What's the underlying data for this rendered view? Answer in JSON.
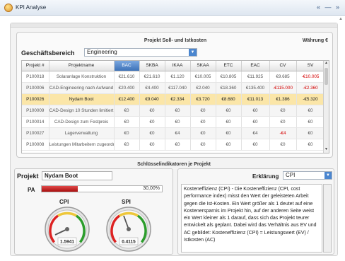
{
  "window": {
    "title": "KPI Analyse",
    "controls": "« — »"
  },
  "top_panel": {
    "title": "Projekt Soll- und Istkosten",
    "currency": "Währung €",
    "geschaeftsbereich_label": "Geschäftsbereich",
    "geschaeftsbereich_value": "Engineering"
  },
  "table": {
    "columns": [
      "Projekt #",
      "Projektname",
      "BAC",
      "SKBA",
      "IKAA",
      "SKAA",
      "ETC",
      "EAC",
      "CV",
      "SV"
    ],
    "sorted_column": "BAC",
    "rows": [
      [
        "P100018",
        "Solaranlage Konstruktion",
        "€21.610",
        "€21.610",
        "€1.120",
        "€10.005",
        "€10.805",
        "€11.925",
        "€9.685",
        "-€10.005"
      ],
      [
        "P100006",
        "CAD-Engineering nach Aufwand",
        "€20.400",
        "€4.400",
        "€117.040",
        "€2.040",
        "€18.360",
        "€135.400",
        "-€115.000",
        "-€2.360"
      ],
      [
        "P100026",
        "Nydam Boot",
        "€12.400",
        "€9.040",
        "€2.334",
        "€3.720",
        "€8.680",
        "€11.013",
        "€1.386",
        "-€5.320"
      ],
      [
        "P100009",
        "CAD-Design 10 Stunden limitiert",
        "€0",
        "€0",
        "€0",
        "€0",
        "€0",
        "€0",
        "€0",
        "€0"
      ],
      [
        "P100014",
        "CAD-Design zum Festpreis",
        "€0",
        "€0",
        "€0",
        "€0",
        "€0",
        "€0",
        "€0",
        "€0"
      ],
      [
        "P100027",
        "Lagerverwaltung",
        "€0",
        "€0",
        "€4",
        "€0",
        "€0",
        "€4",
        "-€4",
        "€0"
      ],
      [
        "P100008",
        "Leistungen Mitarbeitern zugeordnet",
        "€0",
        "€0",
        "€0",
        "€0",
        "€0",
        "€0",
        "€0",
        "€0"
      ]
    ],
    "selected_row": 2
  },
  "key_section_title": "Schlüsselindikatoren je Projekt",
  "project_panel": {
    "projekt_label": "Projekt",
    "projekt_value": "Nydam Boot",
    "pa_label": "PA",
    "pa_value_text": "30,00%",
    "pa_fraction": 0.3,
    "cpi_label": "CPI",
    "cpi_value": "1.5941",
    "spi_label": "SPI",
    "spi_value": "0.4115"
  },
  "explanation_panel": {
    "label": "Erklärung",
    "selected": "CPI",
    "text": "Kosteneffizienz (CPI) - Die Kosteneffizienz (CPI, cost performance index) misst den Wert der geleisteten Arbeit gegen die Ist-Kosten. Ein Wert größer als 1 deutet auf eine Kostenersparnis im Projekt hin, auf der anderen Seite weist ein Wert kleiner als 1 darauf, dass sich das Projekt teurer entwickelt als geplant. Dabei wird das Verhältnis aus EV und AC gebildet: Kosteneffizienz (CPI) = Leistungswert (EV) / Istkosten (AC)"
  },
  "colors": {
    "accent": "#3e72b8",
    "selected_row": "#fbe6a8",
    "negative": "#d40000",
    "pa_bar": "#c81d1d"
  }
}
